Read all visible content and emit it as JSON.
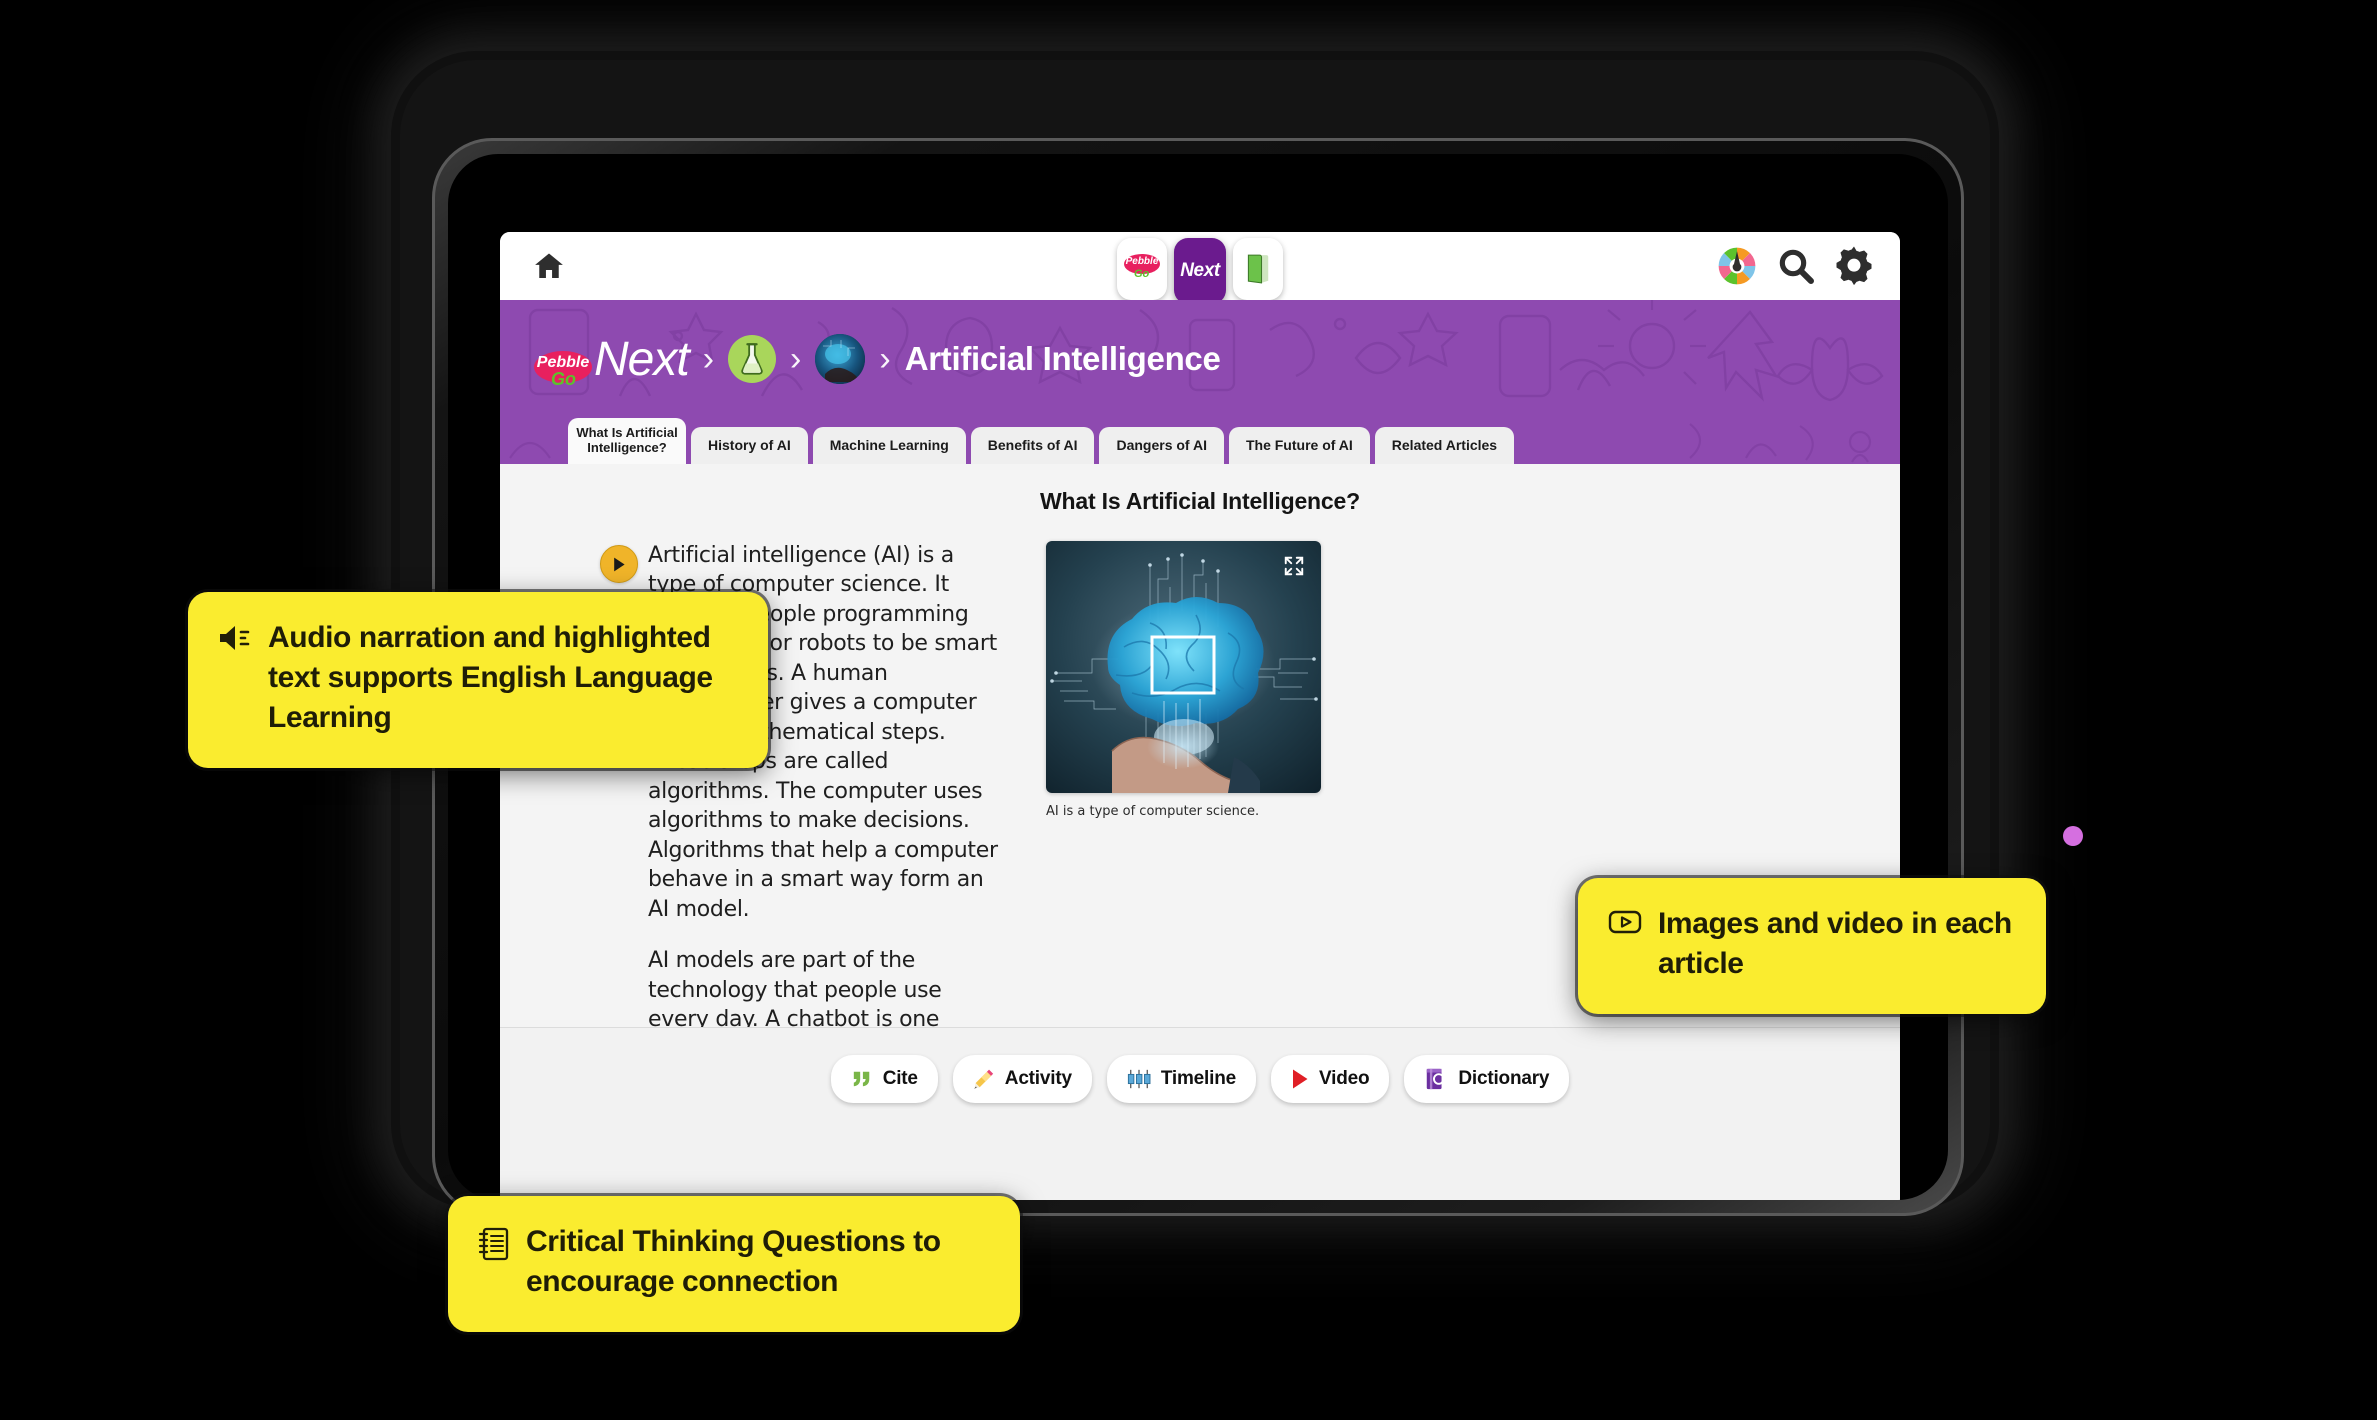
{
  "app": {
    "home_icon": "home-icon",
    "product_switcher": [
      {
        "id": "pebblego",
        "label": "Pebble",
        "sub_label": "Go",
        "active": false
      },
      {
        "id": "next",
        "label": "Next",
        "active": true
      },
      {
        "id": "book",
        "label": "",
        "icon": "green-book-icon",
        "active": false
      }
    ],
    "right_icons": [
      {
        "id": "color-wheel",
        "icon": "color-wheel-icon"
      },
      {
        "id": "search",
        "icon": "search-icon"
      },
      {
        "id": "settings",
        "icon": "gear-icon"
      }
    ]
  },
  "breadcrumb": {
    "logo_badge": "Pebble",
    "logo_go": "Go",
    "logo_next": "Next",
    "separator": "›",
    "science_icon": "flask-icon",
    "thumb_icon": "article-thumbnail",
    "title": "Artificial Intelligence"
  },
  "tabs": [
    {
      "label": "What Is Artificial Intelligence?",
      "active": true
    },
    {
      "label": "History of AI",
      "active": false
    },
    {
      "label": "Machine Learning",
      "active": false
    },
    {
      "label": "Benefits of AI",
      "active": false
    },
    {
      "label": "Dangers of AI",
      "active": false
    },
    {
      "label": "The Future of AI",
      "active": false
    },
    {
      "label": "Related Articles",
      "active": false
    }
  ],
  "article": {
    "title": "What Is Artificial Intelligence?",
    "audio_button": "play-audio-icon",
    "paragraphs": [
      "Artificial intelligence (AI) is a type of computer science. It involves people programming computers or robots to be smart like humans. A human programmer gives a computer sets of mathematical steps. These steps are called algorithms. The computer uses algorithms to make decisions. Algorithms that help a computer behave in a smart way form an AI model.",
      "AI models are part of the technology that people use every day. A chatbot is one example. People may encounter a chatbot on a website or app. Chatbots help answer commonly asked"
    ],
    "figure_caption": "AI is a type of computer science.",
    "figure_alt": "Glowing blue brain with circuit traces held in an open hand",
    "expand_icon": "expand-icon"
  },
  "toolbar": [
    {
      "label": "Cite",
      "icon": "quote-icon"
    },
    {
      "label": "Activity",
      "icon": "pencil-icon"
    },
    {
      "label": "Timeline",
      "icon": "timeline-icon"
    },
    {
      "label": "Video",
      "icon": "play-triangle-icon"
    },
    {
      "label": "Dictionary",
      "icon": "dictionary-book-icon"
    }
  ],
  "callouts": [
    {
      "id": "audio",
      "icon": "speaker-icon",
      "text": "Audio narration and highlighted text supports English Language Learning"
    },
    {
      "id": "media",
      "icon": "video-box-icon",
      "text": "Images and video in each article"
    },
    {
      "id": "ctq",
      "icon": "notebook-icon",
      "text": "Critical Thinking Questions to encourage connection"
    }
  ],
  "colors": {
    "purple": "#8e4ab0",
    "purple_deep": "#6b1b8e",
    "yellow": "#faec2f",
    "pebble_pink": "#e8205f",
    "pebble_green": "#5cc22c",
    "audio_gold": "#f0b429",
    "deco_dot": "#d56fe0"
  }
}
